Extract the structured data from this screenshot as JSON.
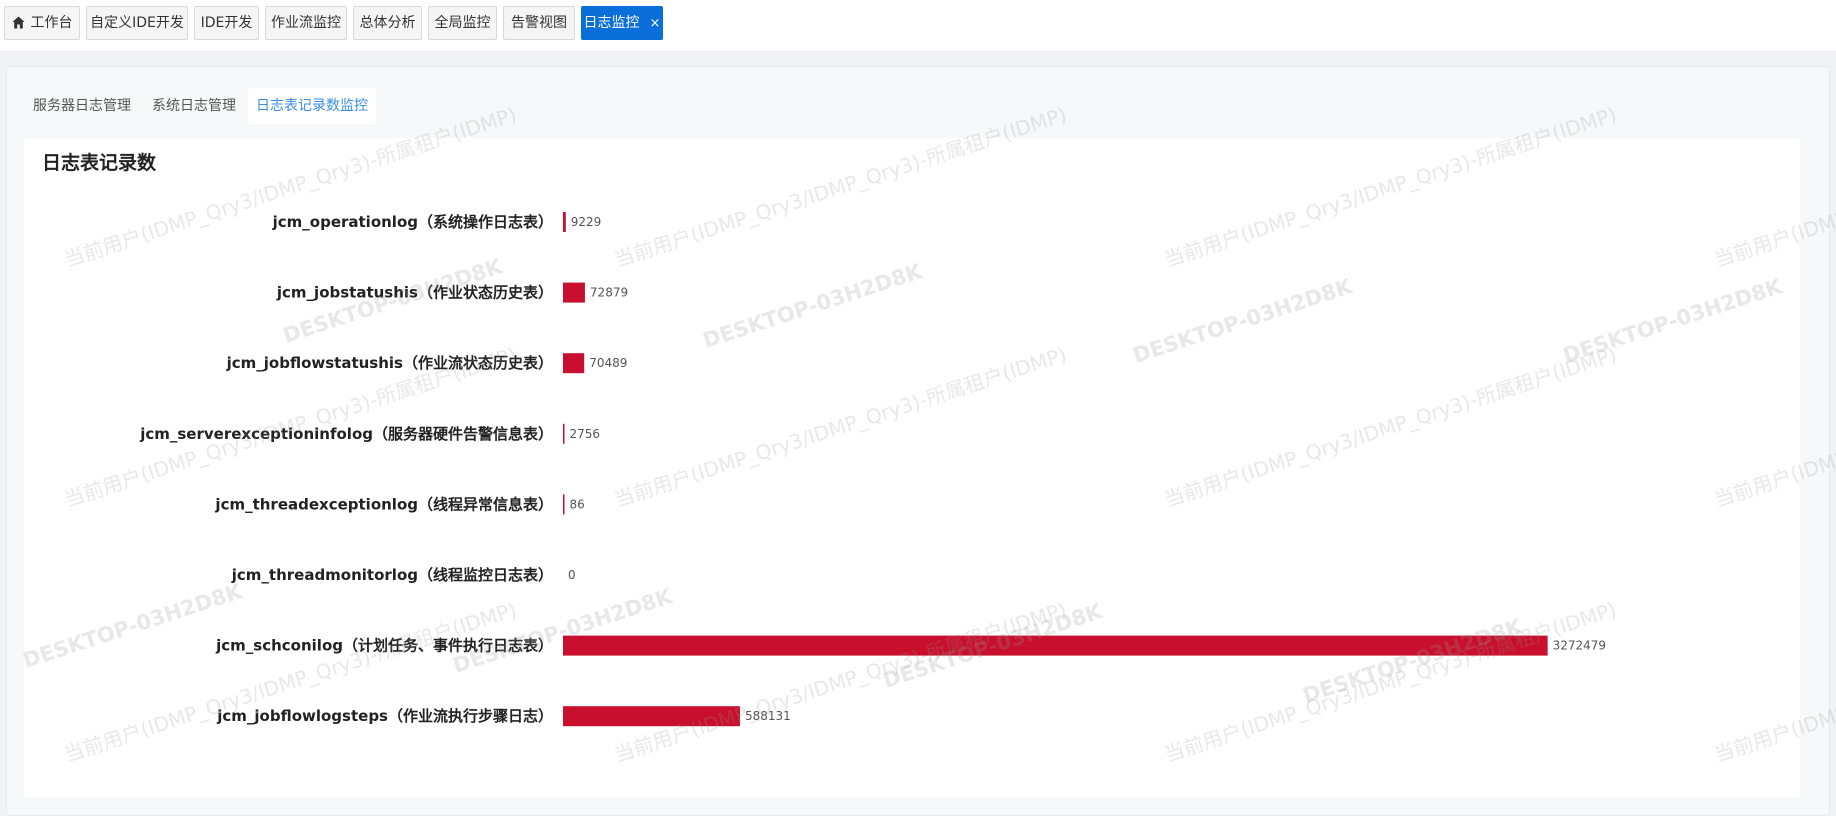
{
  "top_tabs": [
    {
      "label": "工作台",
      "icon": "home-icon"
    },
    {
      "label": "自定义IDE开发"
    },
    {
      "label": "IDE开发"
    },
    {
      "label": "作业流监控"
    },
    {
      "label": "总体分析"
    },
    {
      "label": "全局监控"
    },
    {
      "label": "告警视图"
    },
    {
      "label": "日志监控",
      "active": true,
      "close": "×"
    }
  ],
  "sub_tabs": [
    {
      "label": "服务器日志管理"
    },
    {
      "label": "系统日志管理"
    },
    {
      "label": "日志表记录数监控",
      "active": true
    }
  ],
  "card": {
    "title": "日志表记录数"
  },
  "watermark": {
    "user": "当前用户(IDMP_Qry3/IDMP_Qry3)-所属租户(IDMP)",
    "host": "DESKTOP-03H2D8K"
  },
  "colors": {
    "bar": "#c8102e",
    "accent": "#0a6fd8"
  },
  "chart_data": {
    "type": "bar",
    "orientation": "horizontal",
    "title": "日志表记录数",
    "categories": [
      "jcm_operationlog（系统操作日志表）",
      "jcm_jobstatushis（作业状态历史表）",
      "jcm_jobflowstatushis（作业流状态历史表）",
      "jcm_serverexceptioninfolog（服务器硬件告警信息表）",
      "jcm_threadexceptionlog（线程异常信息表）",
      "jcm_threadmonitorlog（线程监控日志表）",
      "jcm_schconilog（计划任务、事件执行日志表）",
      "jcm_jobflowlogsteps（作业流执行步骤日志）"
    ],
    "values": [
      9229,
      72879,
      70489,
      2756,
      86,
      0,
      3272479,
      588131
    ],
    "xlim": [
      0,
      3400000
    ],
    "grid": false,
    "legend": "none"
  }
}
